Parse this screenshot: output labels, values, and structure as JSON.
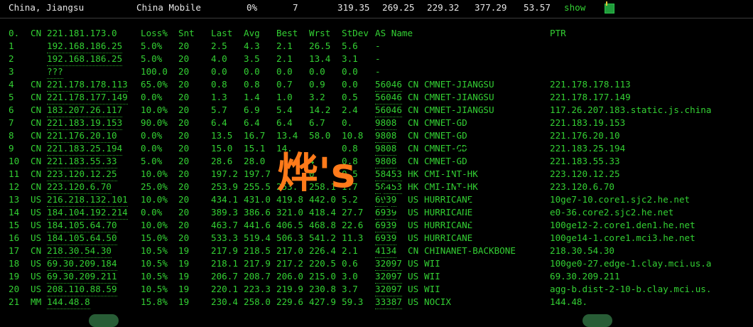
{
  "topbar": {
    "location": "China, Jiangsu",
    "isp": "China Mobile",
    "loss": "0%",
    "sent": "7",
    "v1": "319.35",
    "v2": "269.25",
    "v3": "229.32",
    "v4": "377.29",
    "v5": "53.57",
    "show_link": "show",
    "toggle_color": "#1f9a3a"
  },
  "header": {
    "hop": "0.",
    "cc": "CN",
    "ip": "221.181.173.0",
    "loss": "Loss%",
    "snt": "Snt",
    "last": "Last",
    "avg": "Avg",
    "best": "Best",
    "wrst": "Wrst",
    "stdev": "StDev",
    "asname": "AS Name",
    "ptr": "PTR"
  },
  "rows": [
    {
      "hop": "1",
      "cc": "",
      "ip": "192.168.186.25",
      "loss": "5.0%",
      "snt": "20",
      "last": "2.5",
      "avg": "4.3",
      "best": "2.1",
      "wrst": "26.5",
      "stdev": "5.6",
      "asn": "-",
      "ascc": "",
      "asname": "",
      "ptr": ""
    },
    {
      "hop": "2",
      "cc": "",
      "ip": "192.168.186.25",
      "loss": "5.0%",
      "snt": "20",
      "last": "4.0",
      "avg": "3.5",
      "best": "2.1",
      "wrst": "13.4",
      "stdev": "3.1",
      "asn": "-",
      "ascc": "",
      "asname": "",
      "ptr": ""
    },
    {
      "hop": "3",
      "cc": "",
      "ip": "???",
      "loss": "100.0",
      "snt": "20",
      "last": "0.0",
      "avg": "0.0",
      "best": "0.0",
      "wrst": "0.0",
      "stdev": "0.0",
      "asn": "-",
      "ascc": "",
      "asname": "",
      "ptr": ""
    },
    {
      "hop": "4",
      "cc": "CN",
      "ip": "221.178.178.113",
      "loss": "65.0%",
      "snt": "20",
      "last": "0.8",
      "avg": "0.8",
      "best": "0.7",
      "wrst": "0.9",
      "stdev": "0.0",
      "asn": "56046",
      "ascc": "CN",
      "asname": "CMNET-JIANGSU",
      "ptr": "221.178.178.113"
    },
    {
      "hop": "5",
      "cc": "CN",
      "ip": "221.178.177.149",
      "loss": "0.0%",
      "snt": "20",
      "last": "1.3",
      "avg": "1.4",
      "best": "1.0",
      "wrst": "3.2",
      "stdev": "0.5",
      "asn": "56046",
      "ascc": "CN",
      "asname": "CMNET-JIANGSU",
      "ptr": "221.178.177.149"
    },
    {
      "hop": "6",
      "cc": "CN",
      "ip": "183.207.26.117",
      "loss": "10.0%",
      "snt": "20",
      "last": "5.7",
      "avg": "6.9",
      "best": "5.4",
      "wrst": "14.2",
      "stdev": "2.4",
      "asn": "56046",
      "ascc": "CN",
      "asname": "CMNET-JIANGSU",
      "ptr": "117.26.207.183.static.js.china"
    },
    {
      "hop": "7",
      "cc": "CN",
      "ip": "221.183.19.153",
      "loss": "90.0%",
      "snt": "20",
      "last": "6.4",
      "avg": "6.4",
      "best": "6.4",
      "wrst": "6.7",
      "stdev": "0.",
      "asn": "9808",
      "ascc": "CN",
      "asname": "CMNET-GD",
      "ptr": "221.183.19.153"
    },
    {
      "hop": "8",
      "cc": "CN",
      "ip": "221.176.20.10",
      "loss": "0.0%",
      "snt": "20",
      "last": "13.5",
      "avg": "16.7",
      "best": "13.4",
      "wrst": "58.0",
      "stdev": "10.8",
      "asn": "9808",
      "ascc": "CN",
      "asname": "CMNET-GD",
      "ptr": "221.176.20.10"
    },
    {
      "hop": "9",
      "cc": "CN",
      "ip": "221.183.25.194",
      "loss": "0.0%",
      "snt": "20",
      "last": "15.0",
      "avg": "15.1",
      "best": "14.",
      "wrst": "",
      "stdev": "0.8",
      "asn": "9808",
      "ascc": "CN",
      "asname": "CMNET-GD",
      "ptr": "221.183.25.194"
    },
    {
      "hop": "10",
      "cc": "CN",
      "ip": "221.183.55.33",
      "loss": "5.0%",
      "snt": "20",
      "last": "28.6",
      "avg": "28.0",
      "best": "",
      "wrst": "4",
      "stdev": "0.8",
      "asn": "9808",
      "ascc": "CN",
      "asname": "CMNET-GD",
      "ptr": "221.183.55.33"
    },
    {
      "hop": "11",
      "cc": "CN",
      "ip": "223.120.12.25",
      "loss": "10.0%",
      "snt": "20",
      "last": "197.2",
      "avg": "197.7",
      "best": "",
      "wrst": "0",
      "stdev": "0.5",
      "asn": "58453",
      "ascc": "HK",
      "asname": "CMI-INT-HK",
      "ptr": "223.120.12.25"
    },
    {
      "hop": "12",
      "cc": "CN",
      "ip": "223.120.6.70",
      "loss": "25.0%",
      "snt": "20",
      "last": "253.9",
      "avg": "255.5",
      "best": "253.",
      "wrst": "258.1",
      "stdev": "1.7",
      "asn": "58453",
      "ascc": "HK",
      "asname": "CMI-INT-HK",
      "ptr": "223.120.6.70"
    },
    {
      "hop": "13",
      "cc": "US",
      "ip": "216.218.132.101",
      "loss": "10.0%",
      "snt": "20",
      "last": "434.1",
      "avg": "431.0",
      "best": "419.8",
      "wrst": "442.0",
      "stdev": "5.2",
      "asn": "6939",
      "ascc": "US",
      "asname": "HURRICANE",
      "ptr": "10ge7-10.core1.sjc2.he.net"
    },
    {
      "hop": "14",
      "cc": "US",
      "ip": "184.104.192.214",
      "loss": "0.0%",
      "snt": "20",
      "last": "389.3",
      "avg": "386.6",
      "best": "321.0",
      "wrst": "418.4",
      "stdev": "27.7",
      "asn": "6939",
      "ascc": "US",
      "asname": "HURRICANE",
      "ptr": "e0-36.core2.sjc2.he.net"
    },
    {
      "hop": "15",
      "cc": "US",
      "ip": "184.105.64.70",
      "loss": "10.0%",
      "snt": "20",
      "last": "463.7",
      "avg": "441.6",
      "best": "406.5",
      "wrst": "468.8",
      "stdev": "22.6",
      "asn": "6939",
      "ascc": "US",
      "asname": "HURRICANE",
      "ptr": "100ge12-2.core1.den1.he.net"
    },
    {
      "hop": "16",
      "cc": "US",
      "ip": "184.105.64.50",
      "loss": "15.0%",
      "snt": "20",
      "last": "533.3",
      "avg": "519.4",
      "best": "506.3",
      "wrst": "541.2",
      "stdev": "11.3",
      "asn": "6939",
      "ascc": "US",
      "asname": "HURRICANE",
      "ptr": "100ge14-1.core1.mci3.he.net"
    },
    {
      "hop": "17",
      "cc": "CN",
      "ip": "218.30.54.30",
      "loss": "10.5%",
      "snt": "19",
      "last": "217.9",
      "avg": "218.5",
      "best": "217.0",
      "wrst": "226.4",
      "stdev": "2.1",
      "asn": "4134",
      "ascc": "CN",
      "asname": "CHINANET-BACKBONE",
      "ptr": "218.30.54.30"
    },
    {
      "hop": "18",
      "cc": "US",
      "ip": "69.30.209.184",
      "loss": "10.5%",
      "snt": "19",
      "last": "218.1",
      "avg": "217.9",
      "best": "217.2",
      "wrst": "220.5",
      "stdev": "0.6",
      "asn": "32097",
      "ascc": "US",
      "asname": "WII",
      "ptr": "100ge0-27.edge-1.clay.mci.us.a"
    },
    {
      "hop": "19",
      "cc": "US",
      "ip": "69.30.209.211",
      "loss": "10.5%",
      "snt": "19",
      "last": "206.7",
      "avg": "208.7",
      "best": "206.0",
      "wrst": "215.0",
      "stdev": "3.0",
      "asn": "32097",
      "ascc": "US",
      "asname": "WII",
      "ptr": "69.30.209.211"
    },
    {
      "hop": "20",
      "cc": "US",
      "ip": "208.110.88.59",
      "loss": "10.5%",
      "snt": "19",
      "last": "220.1",
      "avg": "223.3",
      "best": "219.9",
      "wrst": "230.8",
      "stdev": "3.7",
      "asn": "32097",
      "ascc": "US",
      "asname": "WII",
      "ptr": "agg-b.dist-2-10-b.clay.mci.us."
    },
    {
      "hop": "21",
      "cc": "MM",
      "ip": "144.48.8",
      "loss": "15.8%",
      "snt": "19",
      "last": "230.4",
      "avg": "258.0",
      "best": "229.6",
      "wrst": "427.9",
      "stdev": "59.3",
      "asn": "33387",
      "ascc": "US",
      "asname": "NOCIX",
      "ptr": "144.48."
    }
  ],
  "watermark": {
    "text": "烨's",
    "color": "#ff7a1a"
  }
}
